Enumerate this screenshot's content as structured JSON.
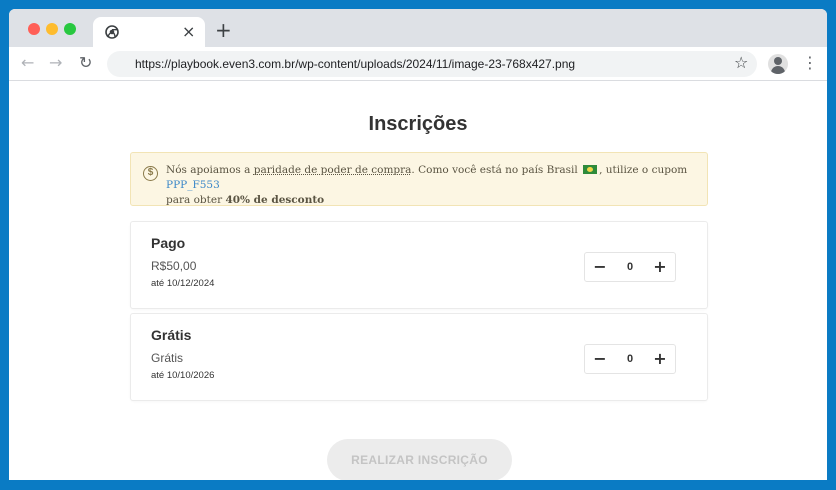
{
  "browser": {
    "url": "https://playbook.even3.com.br/wp-content/uploads/2024/11/image-23-768x427.png",
    "tab_close": "×",
    "new_tab": "+",
    "icons": {
      "back": "←",
      "forward": "→",
      "reload": "↻",
      "bookmark": "☆",
      "menu": "⋮"
    }
  },
  "page": {
    "title": "Inscrições",
    "notice": {
      "icon": "$",
      "text_1": "Nós apoiamos a ",
      "link": "paridade de poder de compra",
      "text_2": ". Como você está no país Brasil ",
      "text_3": ", utilize o cupom ",
      "coupon": "PPP_F553",
      "text_4": "para obter ",
      "discount": "40% de desconto"
    },
    "tickets": [
      {
        "name": "Pago",
        "price": "R$50,00",
        "date": "até 10/12/2024",
        "quantity": "0"
      },
      {
        "name": "Grátis",
        "price": "Grátis",
        "date": "até 10/10/2026",
        "quantity": "0"
      }
    ],
    "stepper": {
      "minus": "−",
      "plus": "+"
    },
    "submit": "REALIZAR INSCRIÇÃO"
  },
  "colors": {
    "frame": "#0a7bc4",
    "notice_bg": "#fcf6e3",
    "coupon": "#3a87c8",
    "button_disabled": "#ececec"
  }
}
